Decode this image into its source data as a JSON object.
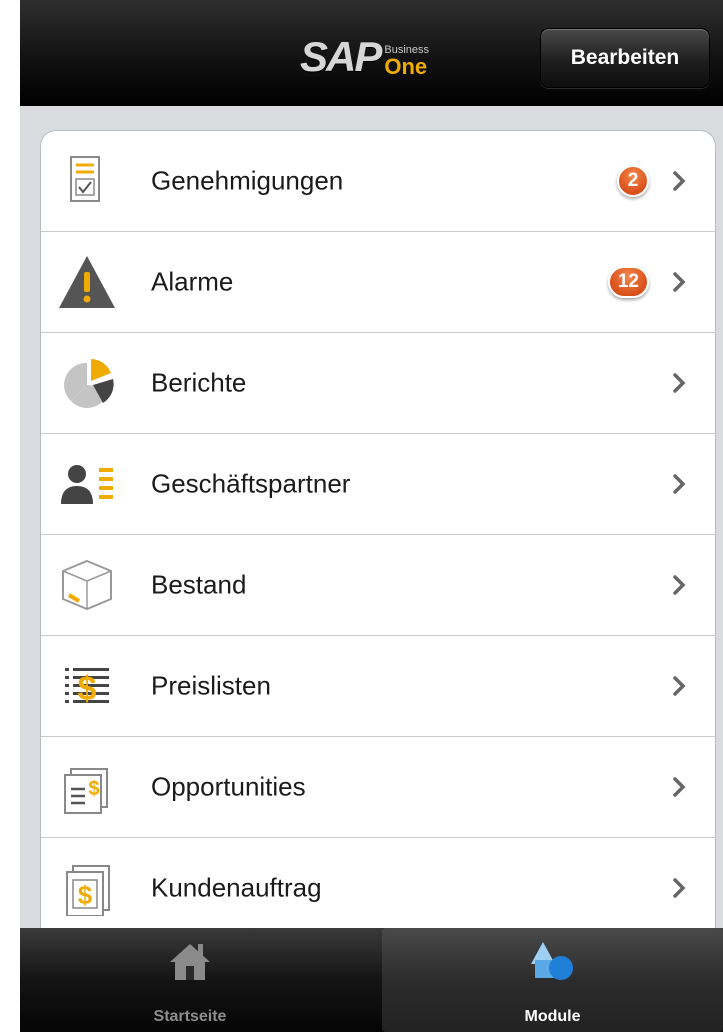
{
  "header": {
    "logo": {
      "sap": "SAP",
      "business": "Business",
      "one": "One"
    },
    "edit_button": "Bearbeiten"
  },
  "modules": [
    {
      "label": "Genehmigungen",
      "icon": "approval-icon",
      "badge": "2"
    },
    {
      "label": "Alarme",
      "icon": "warning-icon",
      "badge": "12"
    },
    {
      "label": "Berichte",
      "icon": "pie-chart-icon",
      "badge": null
    },
    {
      "label": "Geschäftspartner",
      "icon": "business-partner-icon",
      "badge": null
    },
    {
      "label": "Bestand",
      "icon": "inventory-box-icon",
      "badge": null
    },
    {
      "label": "Preislisten",
      "icon": "price-list-icon",
      "badge": null
    },
    {
      "label": "Opportunities",
      "icon": "opportunities-icon",
      "badge": null
    },
    {
      "label": "Kundenauftrag",
      "icon": "sales-order-icon",
      "badge": null
    }
  ],
  "tabbar": {
    "home": "Startseite",
    "modules": "Module",
    "selected": "Module"
  },
  "colors": {
    "accent": "#f0ab00",
    "badge": "#e0581f",
    "bar": "#000000"
  }
}
